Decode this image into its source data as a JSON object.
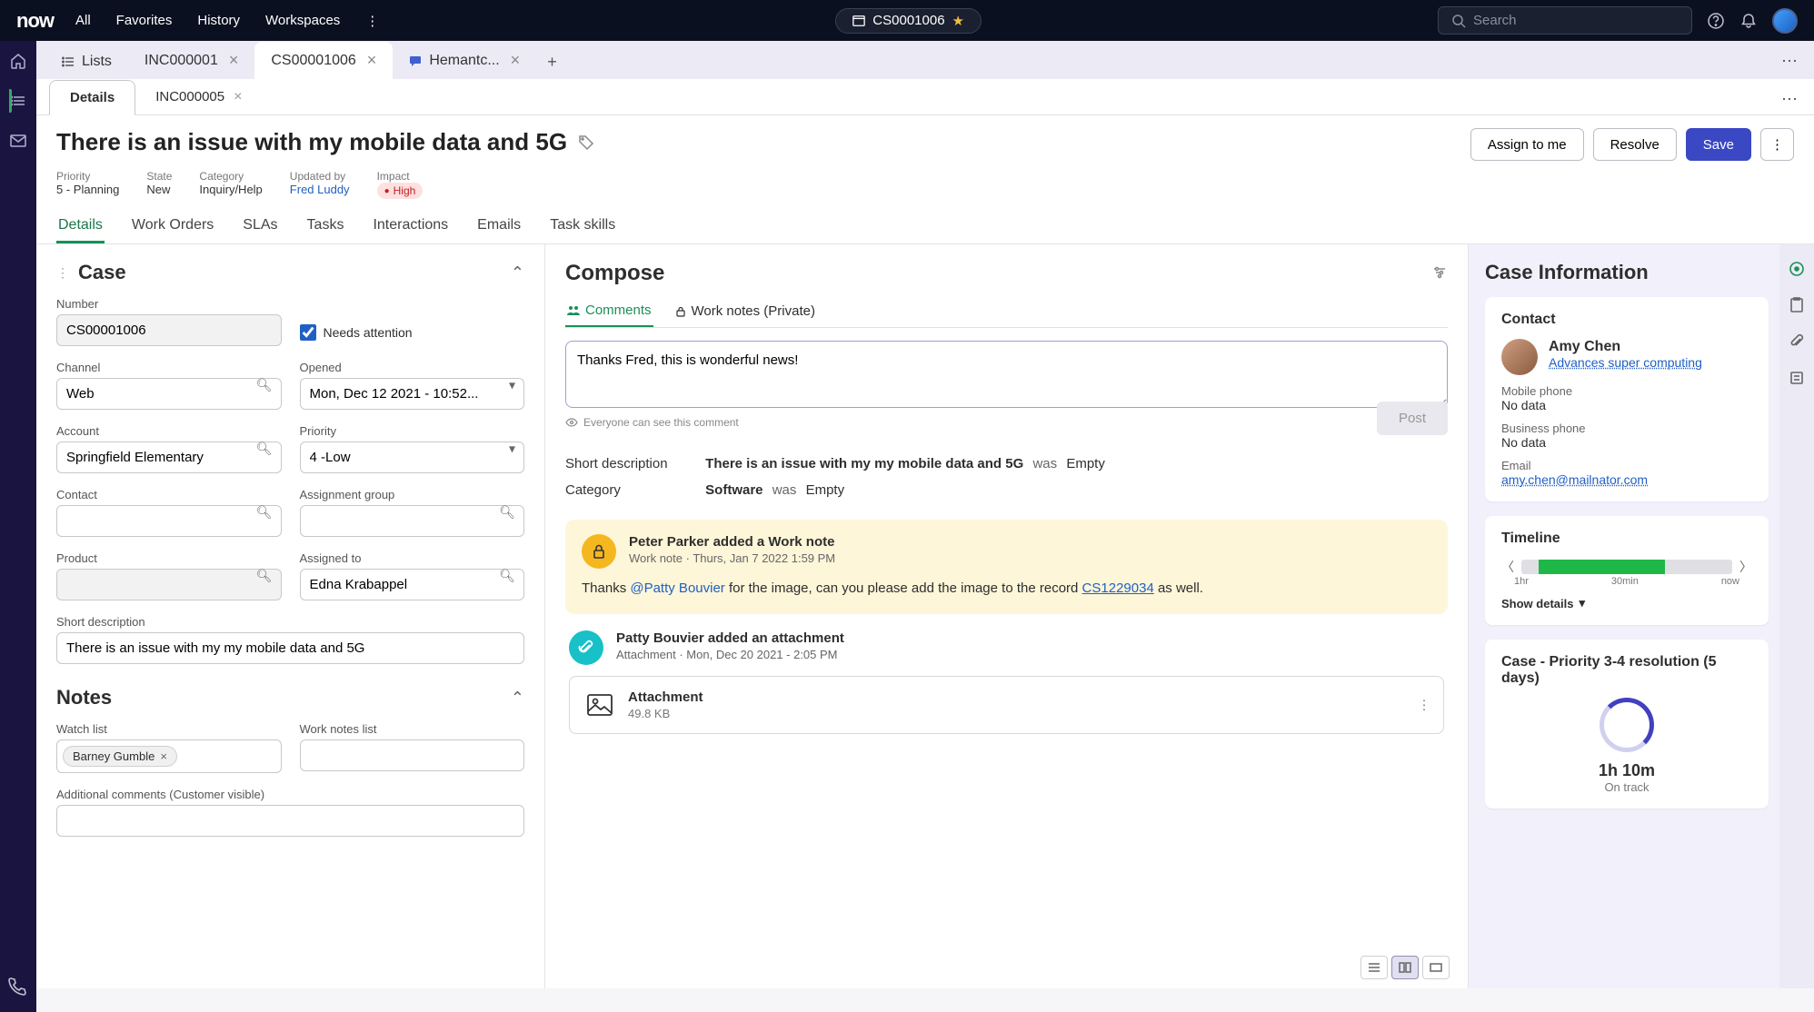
{
  "header": {
    "logo": "now",
    "nav": [
      "All",
      "Favorites",
      "History",
      "Workspaces"
    ],
    "pill_label": "CS0001006",
    "search_placeholder": "Search"
  },
  "tabs_primary": [
    {
      "label": "Lists",
      "icon": "list",
      "closable": false
    },
    {
      "label": "INC000001",
      "closable": true
    },
    {
      "label": "CS00001006",
      "closable": true,
      "active": true
    },
    {
      "label": "Hemantc...",
      "icon": "chat",
      "closable": true
    }
  ],
  "tabs_secondary": [
    {
      "label": "Details",
      "active": true
    },
    {
      "label": "INC000005",
      "closable": true
    }
  ],
  "page": {
    "title": "There is an issue with my mobile data and 5G",
    "actions": {
      "assign": "Assign to me",
      "resolve": "Resolve",
      "save": "Save"
    },
    "meta": {
      "priority_label": "Priority",
      "priority_value": "5 - Planning",
      "state_label": "State",
      "state_value": "New",
      "category_label": "Category",
      "category_value": "Inquiry/Help",
      "updated_label": "Updated by",
      "updated_value": "Fred Luddy",
      "impact_label": "Impact",
      "impact_value": "High"
    },
    "detail_tabs": [
      "Details",
      "Work Orders",
      "SLAs",
      "Tasks",
      "Interactions",
      "Emails",
      "Task skills"
    ]
  },
  "case_form": {
    "heading": "Case",
    "number_label": "Number",
    "number_value": "CS00001006",
    "needs_attention_label": "Needs attention",
    "channel_label": "Channel",
    "channel_value": "Web",
    "opened_label": "Opened",
    "opened_value": "Mon, Dec 12 2021 - 10:52...",
    "account_label": "Account",
    "account_value": "Springfield Elementary",
    "priority_label": "Priority",
    "priority_value": "4 -Low",
    "contact_label": "Contact",
    "contact_value": "",
    "assignment_group_label": "Assignment group",
    "assignment_group_value": "",
    "product_label": "Product",
    "product_value": "",
    "assigned_to_label": "Assigned to",
    "assigned_to_value": "Edna Krabappel",
    "short_desc_label": "Short description",
    "short_desc_value": "There is an issue with my my mobile data and 5G"
  },
  "notes": {
    "heading": "Notes",
    "watch_list_label": "Watch list",
    "watch_chip": "Barney Gumble",
    "work_notes_list_label": "Work notes list",
    "additional_label": "Additional comments (Customer visible)"
  },
  "compose": {
    "heading": "Compose",
    "tab_comments": "Comments",
    "tab_worknotes": "Work notes (Private)",
    "text": "Thanks Fred, this is wonderful news!",
    "hint": "Everyone can see this comment",
    "post": "Post"
  },
  "changes": {
    "short_desc_label": "Short description",
    "short_desc_new": "There is an issue with my my mobile data and 5G",
    "was": "was",
    "empty": "Empty",
    "category_label": "Category",
    "category_new": "Software"
  },
  "activity1": {
    "title": "Peter Parker added a Work note",
    "sub": "Work note   ·   Thurs, Jan 7 2022 1:59 PM",
    "body_pre": "Thanks ",
    "mention": "@Patty Bouvier",
    "body_mid": " for the image, can you please add the image to the record ",
    "record": "CS1229034",
    "body_post": " as well."
  },
  "activity2": {
    "title": "Patty Bouvier added an attachment",
    "sub": "Attachment   ·   Mon, Dec 20 2021 -  2:05 PM",
    "attach_title": "Attachment",
    "attach_size": "49.8 KB"
  },
  "case_info": {
    "heading": "Case Information",
    "contact_heading": "Contact",
    "contact_name": "Amy Chen",
    "contact_sub": "Advances super computing",
    "mobile_label": "Mobile phone",
    "mobile_value": "No data",
    "business_label": "Business phone",
    "business_value": "No data",
    "email_label": "Email",
    "email_value": "amy.chen@mailnator.com",
    "timeline_heading": "Timeline",
    "tl_1hr": "1hr",
    "tl_30min": "30min",
    "tl_now": "now",
    "show_details": "Show details",
    "sla_heading": "Case - Priority 3-4 resolution (5 days)",
    "sla_time": "1h 10m",
    "sla_status": "On track"
  }
}
